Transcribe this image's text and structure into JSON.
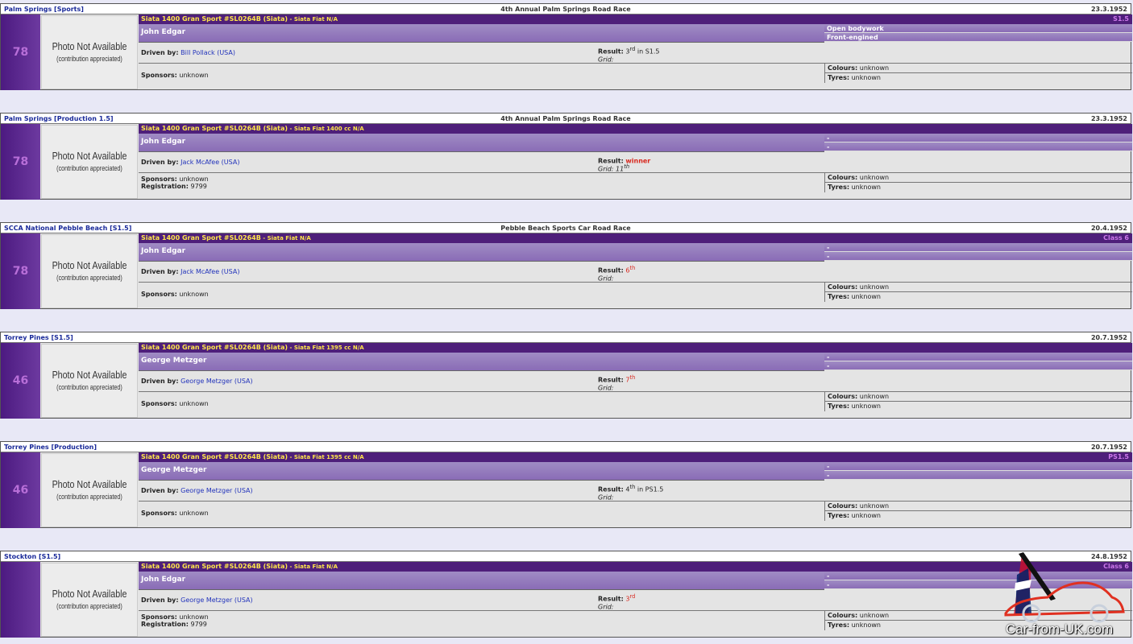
{
  "labels": {
    "photo_line1": "Photo Not Available",
    "photo_line2": "(contribution appreciated)",
    "driven_by": "Driven by:",
    "result": "Result:",
    "grid": "Grid:",
    "sponsors": "Sponsors:",
    "registration": "Registration:",
    "colours": "Colours:",
    "tyres": "Tyres:"
  },
  "races": [
    {
      "event": "Palm Springs [Sports]",
      "race": "4th Annual Palm Springs Road Race",
      "date": "23.3.1952",
      "number": "78",
      "car": "Siata 1400 Gran Sport #SL0264B (Siata)",
      "car_sub": " - Siata Fiat N/A",
      "class": "S1.5",
      "entrant": "John Edgar",
      "attr1": "Open bodywork",
      "attr2": "Front-engined",
      "driver": "Bill Pollack (USA)",
      "result": "3",
      "result_sup": "rd",
      "result_tail": " in S1.5",
      "grid": "",
      "grid_sup": "",
      "sponsors": "unknown",
      "registration": "",
      "colours": "unknown",
      "tyres": "unknown"
    },
    {
      "event": "Palm Springs [Production 1.5]",
      "race": "4th Annual Palm Springs Road Race",
      "date": "23.3.1952",
      "number": "78",
      "car": "Siata 1400 Gran Sport #SL0264B (Siata)",
      "car_sub": " - Siata Fiat 1400 cc N/A",
      "class": "",
      "entrant": "John Edgar",
      "attr1": "-",
      "attr2": "-",
      "driver": "Jack McAfee (USA)",
      "result": "winner",
      "result_sup": "",
      "result_tail": "",
      "grid": "11",
      "grid_sup": "th",
      "sponsors": "unknown",
      "registration": "9799",
      "colours": "unknown",
      "tyres": "unknown"
    },
    {
      "event": "SCCA National Pebble Beach [S1.5]",
      "race": "Pebble Beach Sports Car Road Race",
      "date": "20.4.1952",
      "number": "78",
      "car": "Siata 1400 Gran Sport #SL0264B",
      "car_sub": " - Siata Fiat N/A",
      "class": "Class 6",
      "entrant": "John Edgar",
      "attr1": "-",
      "attr2": "-",
      "driver": "Jack McAfee (USA)",
      "result": "6",
      "result_sup": "th",
      "result_tail": "",
      "grid": "",
      "grid_sup": "",
      "sponsors": "unknown",
      "registration": "",
      "colours": "unknown",
      "tyres": "unknown"
    },
    {
      "event": "Torrey Pines [S1.5]",
      "race": "",
      "date": "20.7.1952",
      "number": "46",
      "car": "Siata 1400 Gran Sport #SL0264B (Siata)",
      "car_sub": " - Siata Fiat 1395 cc N/A",
      "class": "",
      "entrant": "George Metzger",
      "attr1": "-",
      "attr2": "-",
      "driver": "George Metzger (USA)",
      "result": "7",
      "result_sup": "th",
      "result_tail": "",
      "grid": "",
      "grid_sup": "",
      "sponsors": "unknown",
      "registration": "",
      "colours": "unknown",
      "tyres": "unknown"
    },
    {
      "event": "Torrey Pines [Production]",
      "race": "",
      "date": "20.7.1952",
      "number": "46",
      "car": "Siata 1400 Gran Sport #SL0264B (Siata)",
      "car_sub": " - Siata Fiat 1395 cc N/A",
      "class": "PS1.5",
      "entrant": "George Metzger",
      "attr1": "-",
      "attr2": "-",
      "driver": "George Metzger (USA)",
      "result": "4",
      "result_sup": "th",
      "result_tail": " in PS1.5",
      "grid": "",
      "grid_sup": "",
      "sponsors": "unknown",
      "registration": "",
      "colours": "unknown",
      "tyres": "unknown"
    },
    {
      "event": "Stockton [S1.5]",
      "race": "",
      "date": "24.8.1952",
      "number": "",
      "car": "Siata 1400 Gran Sport #SL0264B (Siata)",
      "car_sub": " - Siata Fiat N/A",
      "class": "Class 6",
      "entrant": "John Edgar",
      "attr1": "-",
      "attr2": "-",
      "driver": "George Metzger (USA)",
      "result": "3",
      "result_sup": "rd",
      "result_tail": "",
      "grid": "",
      "grid_sup": "",
      "sponsors": "unknown",
      "registration": "9799",
      "colours": "unknown",
      "tyres": "unknown"
    }
  ],
  "watermark": {
    "text": "Car-from-UK.com"
  },
  "colors": {
    "header_link": "#1a2a9a",
    "car_bar": "#4e1f7a",
    "car_text": "#ffe54a",
    "class_text": "#cc79ea",
    "number_text": "#b86fd8",
    "result_red": "#d8281e"
  }
}
